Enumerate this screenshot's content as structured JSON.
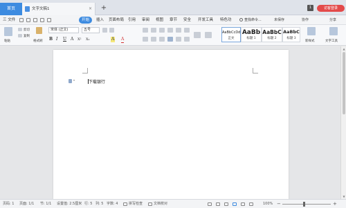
{
  "titlebar": {
    "home_label": "首页",
    "doc_tab_title": "文字文稿1",
    "doc_tab_close": "×",
    "new_tab": "+",
    "window_badge": "1",
    "login_label": "访客登录"
  },
  "menubar": {
    "file_label": "三 文件",
    "items": [
      {
        "label": "开始",
        "active": true
      },
      {
        "label": "插入"
      },
      {
        "label": "页面布局"
      },
      {
        "label": "引用"
      },
      {
        "label": "审阅"
      },
      {
        "label": "视图"
      },
      {
        "label": "章节"
      },
      {
        "label": "安全"
      },
      {
        "label": "开发工具"
      },
      {
        "label": "特色功"
      }
    ],
    "search_label": "查找命令...",
    "unsaved_label": "未保存",
    "collab_label": "协作",
    "share_label": "分享"
  },
  "ribbon": {
    "paste_label": "粘贴",
    "cut_label": "剪切",
    "copy_label": "复制",
    "format_painter_label": "格式刷",
    "font_name": "宋体 (正文)",
    "font_size": "五号",
    "format_buttons": [
      "B",
      "I",
      "U",
      "A",
      "X²",
      "X₂",
      "A",
      "A"
    ],
    "styles": [
      {
        "sample": "AaBbCcDd",
        "name": "正文"
      },
      {
        "sample": "AaBb",
        "name": "标题 1"
      },
      {
        "sample": "AaBbC",
        "name": "标题 2"
      },
      {
        "sample": "AaBbC",
        "name": "标题 3"
      }
    ],
    "new_style_label": "新样式",
    "text_tools_label": "文字工具"
  },
  "document": {
    "line_text": "下载银行"
  },
  "statusbar": {
    "page_num": "页码: 1",
    "pages": "页面: 1/1",
    "section": "节: 1/1",
    "setting": "设置值: 2.5厘米",
    "row": "行: 5",
    "col": "列: 5",
    "words": "字数: 4",
    "spell_check": "拼写检查",
    "doc_proof": "文档校对",
    "zoom": "100%"
  },
  "colors": {
    "accent": "#3d8be0",
    "login_red": "#e34a4a"
  }
}
